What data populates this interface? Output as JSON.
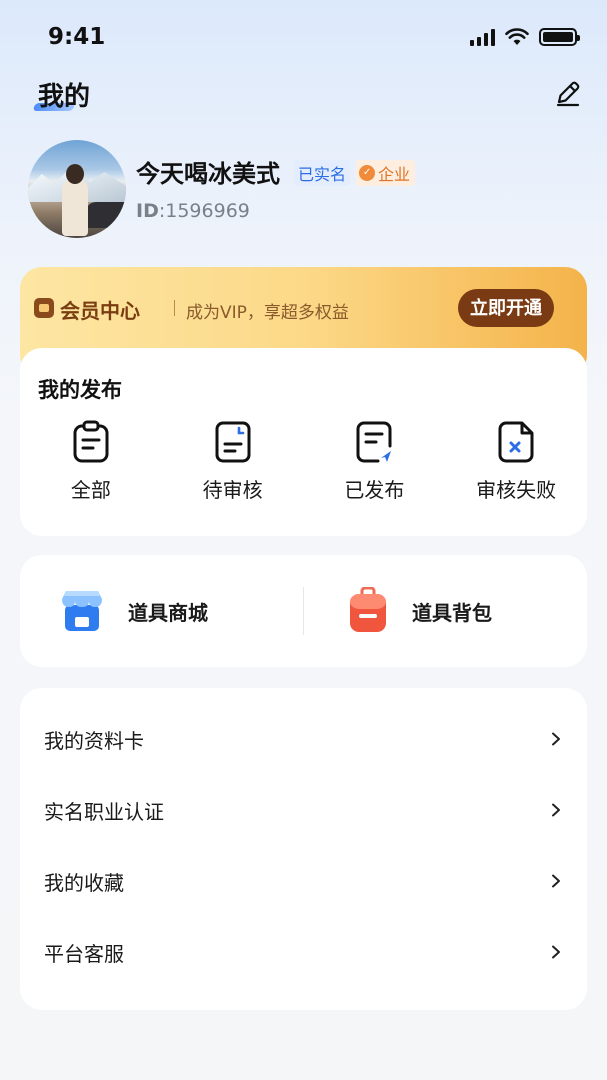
{
  "status_bar": {
    "time": "9:41"
  },
  "header": {
    "title": "我的",
    "edit_icon": "pencil-icon"
  },
  "profile": {
    "nickname": "今天喝冰美式",
    "verified_badge": "已实名",
    "enterprise_badge": "企业",
    "id_label": "ID",
    "id_separator": ":",
    "id_value": "1596969"
  },
  "vip": {
    "title": "会员中心",
    "subtitle": "成为VIP，享超多权益",
    "button": "立即开通",
    "accent_color": "#7a3b14"
  },
  "publish": {
    "title": "我的发布",
    "items": [
      {
        "label": "全部",
        "icon": "document-all-icon"
      },
      {
        "label": "待审核",
        "icon": "document-pending-icon"
      },
      {
        "label": "已发布",
        "icon": "document-published-icon"
      },
      {
        "label": "审核失败",
        "icon": "document-failed-icon"
      }
    ]
  },
  "tools": {
    "shop": {
      "label": "道具商城",
      "icon": "shop-icon"
    },
    "bag": {
      "label": "道具背包",
      "icon": "backpack-icon"
    }
  },
  "menu": {
    "items": [
      {
        "label": "我的资料卡"
      },
      {
        "label": "实名职业认证"
      },
      {
        "label": "我的收藏"
      },
      {
        "label": "平台客服"
      }
    ]
  }
}
